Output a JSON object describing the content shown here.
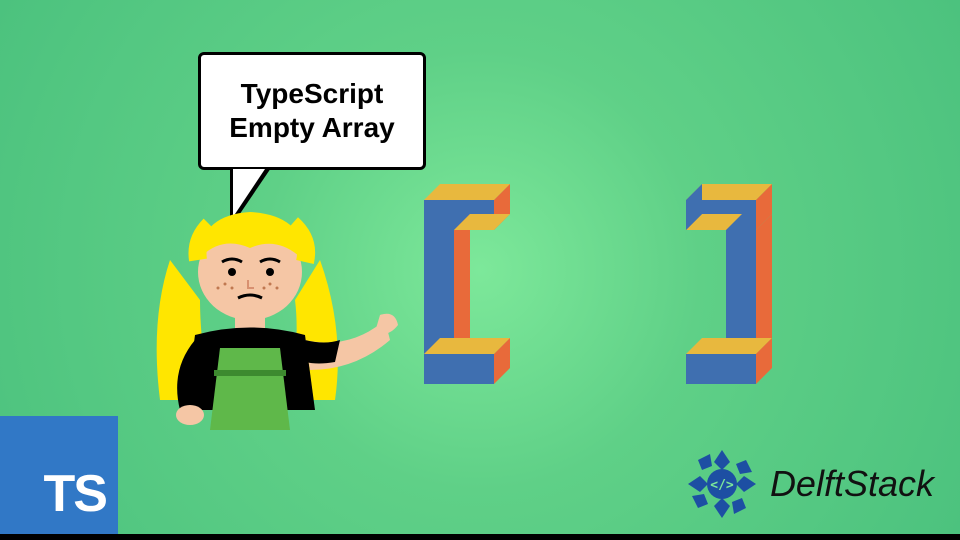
{
  "bubble": {
    "line1": "TypeScript",
    "line2": "Empty Array"
  },
  "ts_badge": {
    "label": "TS"
  },
  "logo": {
    "text": "DelftStack"
  },
  "colors": {
    "ts_blue": "#3178c6",
    "bracket_blue": "#3f6fb0",
    "bracket_yellow": "#e8b83e",
    "bracket_orange": "#e86a3a",
    "hair": "#ffe600",
    "skin": "#f5c6a5",
    "shirt": "#000",
    "apron": "#5fb84a",
    "logo_accent": "#1d4fa3"
  }
}
